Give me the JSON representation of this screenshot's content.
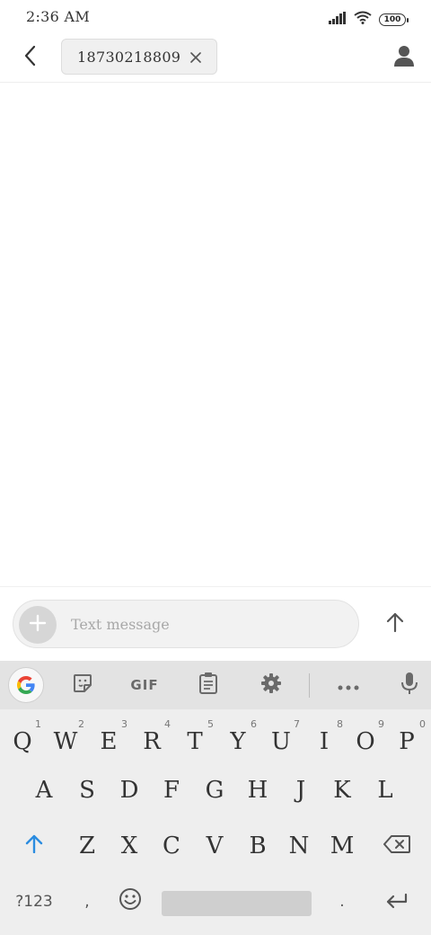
{
  "status_bar": {
    "time": "2:36 AM",
    "battery_level": "100",
    "icons": [
      "signal-icon",
      "wifi-icon",
      "battery-icon"
    ]
  },
  "header": {
    "back_icon": "chevron-left-icon",
    "recipient": "18730218809",
    "clear_icon": "close-icon",
    "contact_icon": "person-icon"
  },
  "compose": {
    "attach_icon": "plus-icon",
    "placeholder": "Text message",
    "value": "",
    "send_icon": "arrow-up-icon"
  },
  "keyboard": {
    "toolbar": {
      "items": [
        "google-icon",
        "sticker-icon",
        "gif",
        "clipboard-icon",
        "gear-icon",
        "more-icon",
        "mic-icon"
      ],
      "gif_label": "GIF"
    },
    "row1": [
      {
        "label": "Q",
        "hint": "1"
      },
      {
        "label": "W",
        "hint": "2"
      },
      {
        "label": "E",
        "hint": "3"
      },
      {
        "label": "R",
        "hint": "4"
      },
      {
        "label": "T",
        "hint": "5"
      },
      {
        "label": "Y",
        "hint": "6"
      },
      {
        "label": "U",
        "hint": "7"
      },
      {
        "label": "I",
        "hint": "8"
      },
      {
        "label": "O",
        "hint": "9"
      },
      {
        "label": "P",
        "hint": "0"
      }
    ],
    "row2": [
      "A",
      "S",
      "D",
      "F",
      "G",
      "H",
      "J",
      "K",
      "L"
    ],
    "row3": [
      "Z",
      "X",
      "C",
      "V",
      "B",
      "N",
      "M"
    ],
    "bottom": {
      "symbols_label": "?123",
      "comma": ",",
      "period": ".",
      "emoji_icon": "emoji-icon",
      "enter_icon": "enter-icon"
    },
    "colors": {
      "shift_accent": "#2b8ce0",
      "background": "#eeeeee",
      "toolbar_bg": "#e3e3e3"
    }
  }
}
